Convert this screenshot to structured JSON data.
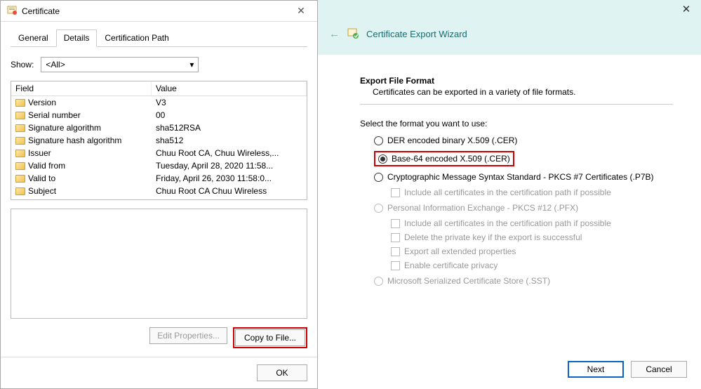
{
  "cert_dialog": {
    "title": "Certificate",
    "tabs": [
      "General",
      "Details",
      "Certification Path"
    ],
    "active_tab": 1,
    "show_label": "Show:",
    "show_value": "<All>",
    "columns": [
      "Field",
      "Value"
    ],
    "rows": [
      {
        "field": "Version",
        "value": "V3"
      },
      {
        "field": "Serial number",
        "value": "00"
      },
      {
        "field": "Signature algorithm",
        "value": "sha512RSA"
      },
      {
        "field": "Signature hash algorithm",
        "value": "sha512"
      },
      {
        "field": "Issuer",
        "value": "Chuu Root CA, Chuu Wireless,..."
      },
      {
        "field": "Valid from",
        "value": "Tuesday, April 28, 2020 11:58..."
      },
      {
        "field": "Valid to",
        "value": "Friday, April 26, 2030 11:58:0..."
      },
      {
        "field": "Subject",
        "value": "Chuu Root CA  Chuu Wireless"
      }
    ],
    "edit_btn": "Edit Properties...",
    "copy_btn": "Copy to File...",
    "ok_btn": "OK"
  },
  "wizard": {
    "title": "Certificate Export Wizard",
    "section_title": "Export File Format",
    "section_sub": "Certificates can be exported in a variety of file formats.",
    "select_label": "Select the format you want to use:",
    "options": {
      "der": "DER encoded binary X.509 (.CER)",
      "base64": "Base-64 encoded X.509 (.CER)",
      "pkcs7": "Cryptographic Message Syntax Standard - PKCS #7 Certificates (.P7B)",
      "pkcs7_sub": "Include all certificates in the certification path if possible",
      "pfx": "Personal Information Exchange - PKCS #12 (.PFX)",
      "pfx_sub1": "Include all certificates in the certification path if possible",
      "pfx_sub2": "Delete the private key if the export is successful",
      "pfx_sub3": "Export all extended properties",
      "pfx_sub4": "Enable certificate privacy",
      "sst": "Microsoft Serialized Certificate Store (.SST)"
    },
    "next_btn": "Next",
    "cancel_btn": "Cancel"
  }
}
